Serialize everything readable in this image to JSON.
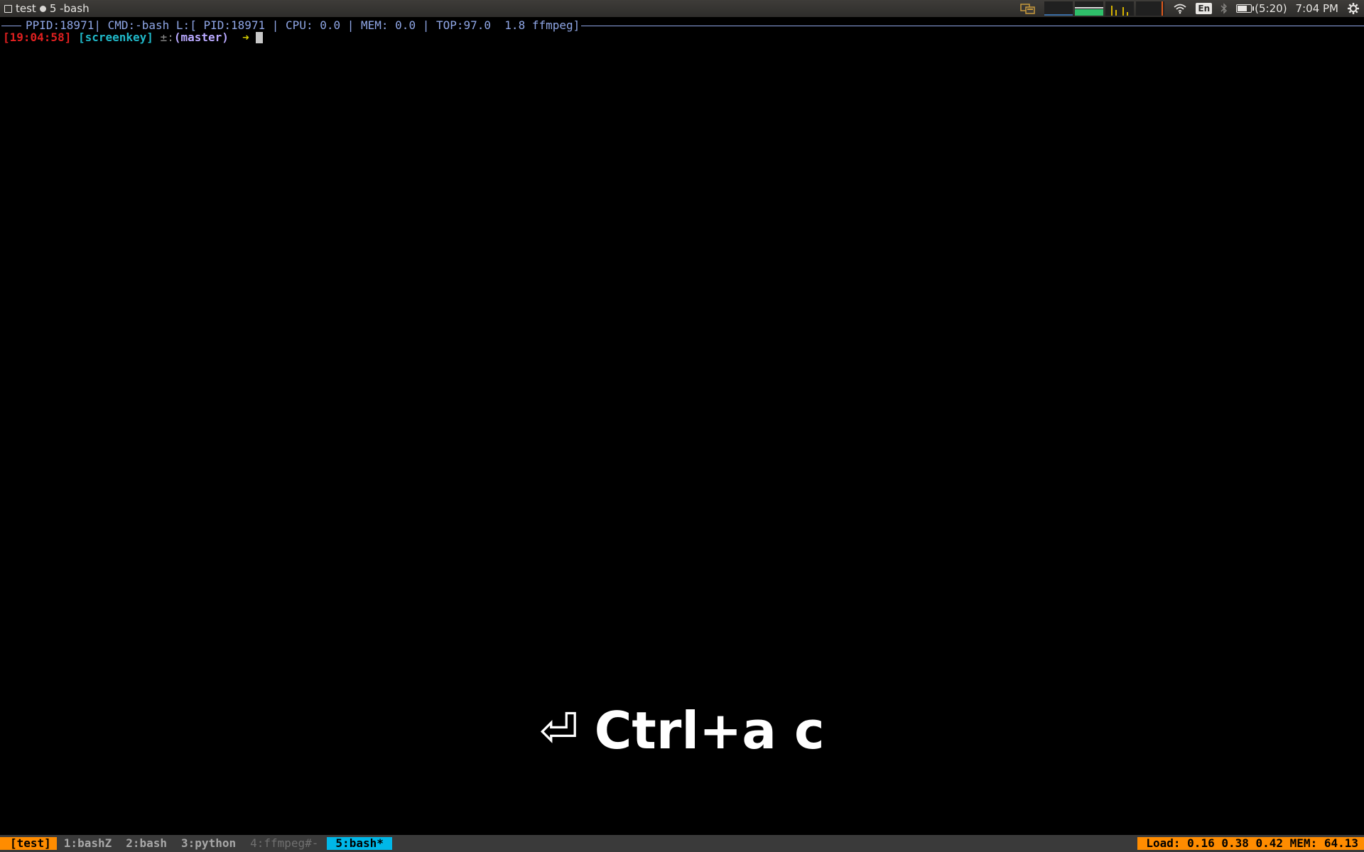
{
  "panel": {
    "window_label": "test",
    "window_title": "5 -bash",
    "battery_time": "(5:20)",
    "clock": "7:04 PM",
    "language": "En",
    "battery_level": 0.7
  },
  "terminal": {
    "status_line": "PPID:18971| CMD:-bash L:[ PID:18971 | CPU: 0.0 | MEM: 0.0 | TOP:97.0  1.8 ffmpeg]",
    "prompt": {
      "time": "[19:04:58]",
      "dir": "[screenkey]",
      "git_symbol": "±:",
      "branch": "(master)",
      "arrow": "➜"
    },
    "screenkey": {
      "icon": "⏎",
      "keys": "Ctrl+a c"
    }
  },
  "tmux": {
    "session": "[test]",
    "windows": [
      {
        "label": "1:bashZ"
      },
      {
        "label": "2:bash"
      },
      {
        "label": "3:python"
      },
      {
        "label": "4:ffmpeg#-"
      },
      {
        "label": "5:bash*"
      }
    ],
    "sysinfo": "Load: 0.16 0.38 0.42 MEM: 64.13"
  },
  "colors": {
    "tmux_accent": "#ff8c00",
    "tmux_active": "#00b7e8",
    "prompt_time": "#e02020",
    "prompt_dir": "#20b8c8",
    "status_text": "#8fa6e6"
  }
}
